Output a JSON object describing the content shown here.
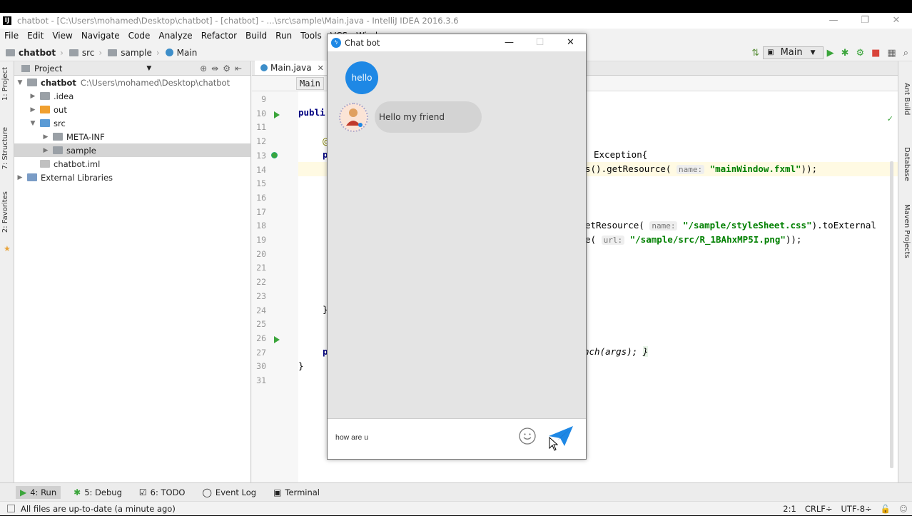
{
  "ide": {
    "window_title": "chatbot - [C:\\Users\\mohamed\\Desktop\\chatbot] - [chatbot] - ...\\src\\sample\\Main.java - IntelliJ IDEA 2016.3.6",
    "menu": [
      "File",
      "Edit",
      "View",
      "Navigate",
      "Code",
      "Analyze",
      "Refactor",
      "Build",
      "Run",
      "Tools",
      "VCS",
      "Window"
    ],
    "breadcrumbs": [
      "chatbot",
      "src",
      "sample",
      "Main"
    ],
    "run_config": "Main",
    "project_panel": {
      "title": "Project",
      "tree": [
        {
          "label": "chatbot",
          "path": "C:\\Users\\mohamed\\Desktop\\chatbot",
          "level": 0,
          "arrow": "▼",
          "color": "#9aa0a6",
          "bold": true
        },
        {
          "label": ".idea",
          "level": 1,
          "arrow": "▶",
          "color": "#9aa0a6"
        },
        {
          "label": "out",
          "level": 1,
          "arrow": "▶",
          "color": "#f0a030"
        },
        {
          "label": "src",
          "level": 1,
          "arrow": "▼",
          "color": "#5b9bd5"
        },
        {
          "label": "META-INF",
          "level": 2,
          "arrow": "▶",
          "color": "#9aa0a6"
        },
        {
          "label": "sample",
          "level": 2,
          "arrow": "▶",
          "color": "#9aa0a6",
          "selected": true
        },
        {
          "label": "chatbot.iml",
          "level": 1,
          "arrow": "",
          "color": "#c0c0c0"
        },
        {
          "label": "External Libraries",
          "level": 0,
          "arrow": "▶",
          "color": "#7a9cc6"
        }
      ]
    },
    "editor": {
      "tab": "Main.java",
      "crumb": "Main",
      "line_numbers": [
        "9",
        "10",
        "11",
        "12",
        "13",
        "14",
        "15",
        "16",
        "17",
        "18",
        "19",
        "20",
        "21",
        "22",
        "23",
        "24",
        "25",
        "26",
        "27",
        "30",
        "31"
      ],
      "code": {
        "publi": "publi",
        "l12_at": "@",
        "l13_p": "p",
        "l13_exception": "Exception{",
        "l14_a": "s().getResource(",
        "l14_hint": "name:",
        "l14_str": "\"mainWindow.fxml\"",
        "l14_end": "));",
        "l18_a": "etResource(",
        "l18_hint": "name:",
        "l18_str": "\"/sample/styleSheet.css\"",
        "l18_end": ").toExternal",
        "l19_a": "e(",
        "l19_hint": "url:",
        "l19_str": "\"/sample/src/R_1BAhxMP5I.png\"",
        "l19_end": "));",
        "l24": "}",
        "l27_p": "p",
        "l27_a": "nch(args);",
        "l27_b": "}",
        "l30": "}"
      }
    },
    "left_tabs": [
      "1: Project",
      "7: Structure",
      "2: Favorites"
    ],
    "right_tabs": [
      "Ant Build",
      "Database",
      "Maven Projects"
    ],
    "bottom_tabs": [
      {
        "label": "4: Run",
        "icon": "▶"
      },
      {
        "label": "5: Debug",
        "icon": "✱"
      },
      {
        "label": "6: TODO",
        "icon": "☑"
      },
      {
        "label": "Event Log",
        "icon": "◯"
      },
      {
        "label": "Terminal",
        "icon": "▣"
      }
    ],
    "status_message": "All files are up-to-date (a minute ago)",
    "status_right": {
      "position": "2:1",
      "line_sep": "CRLF÷",
      "encoding": "UTF-8÷"
    }
  },
  "chat": {
    "title": "Chat bot",
    "outgoing": "hello",
    "incoming": "Hello my friend",
    "input_value": "how are u"
  }
}
